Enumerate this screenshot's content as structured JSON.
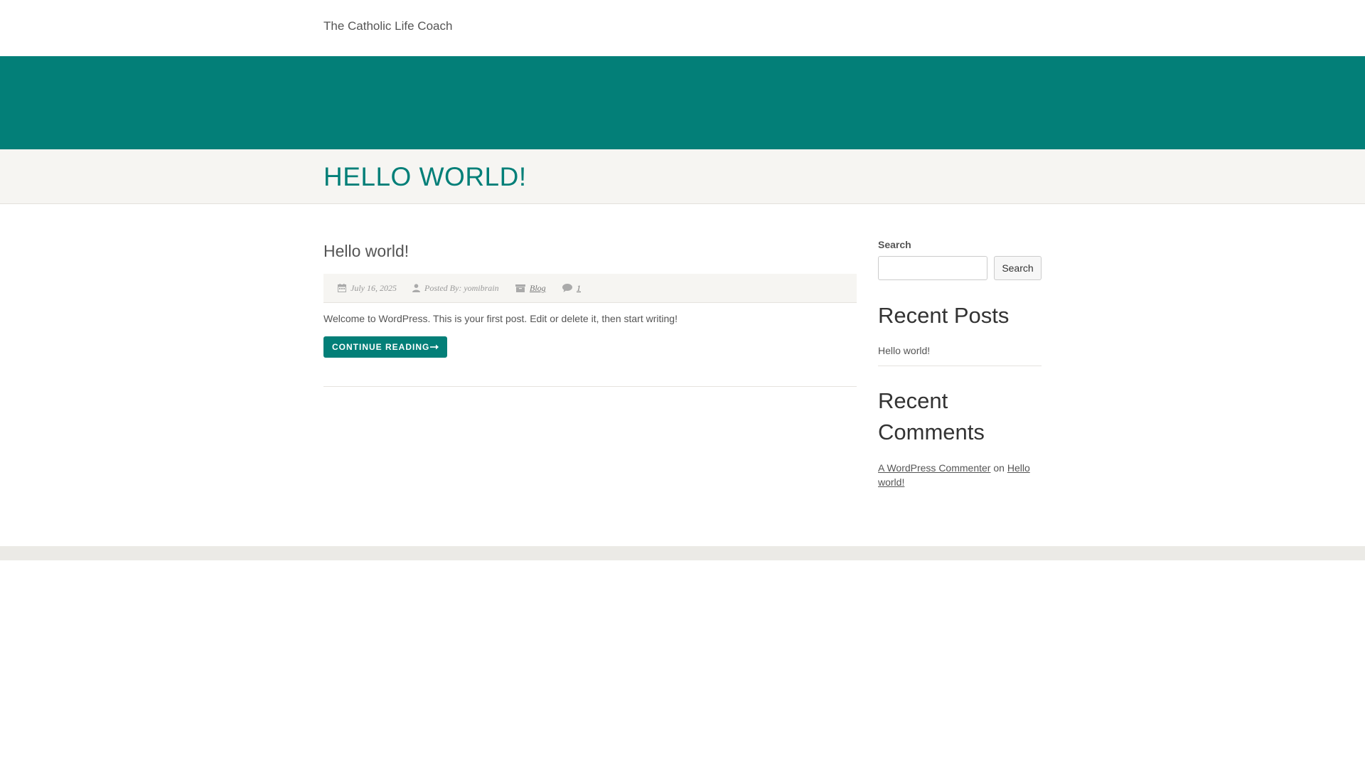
{
  "header": {
    "site_title": "The Catholic Life Coach"
  },
  "page": {
    "title": "HELLO WORLD!"
  },
  "post": {
    "title": "Hello world!",
    "meta": {
      "date": "July 16, 2025",
      "author": "Posted By: yomibrain",
      "category": "Blog",
      "comments": "1"
    },
    "summary": "Welcome to WordPress. This is your first post. Edit or delete it, then start writing!",
    "continue_label": "CONTINUE READING"
  },
  "sidebar": {
    "search": {
      "label": "Search",
      "value": "",
      "button_label": "Search"
    },
    "recent_posts": {
      "title": "Recent Posts",
      "items": [
        "Hello world!"
      ]
    },
    "recent_comments": {
      "title_line1": "Recent",
      "title_line2": "Comments",
      "items": [
        {
          "author": "A WordPress Commenter",
          "connector": "on",
          "post": "Hello world!"
        }
      ]
    }
  },
  "colors": {
    "accent": "#037f78",
    "band": "#f6f5f2",
    "footer": "#ebeae6"
  },
  "icons": {
    "date": "calendar-icon",
    "author": "user-icon",
    "category": "folder-icon",
    "comments": "comment-icon",
    "continue": "arrow-right-icon"
  }
}
